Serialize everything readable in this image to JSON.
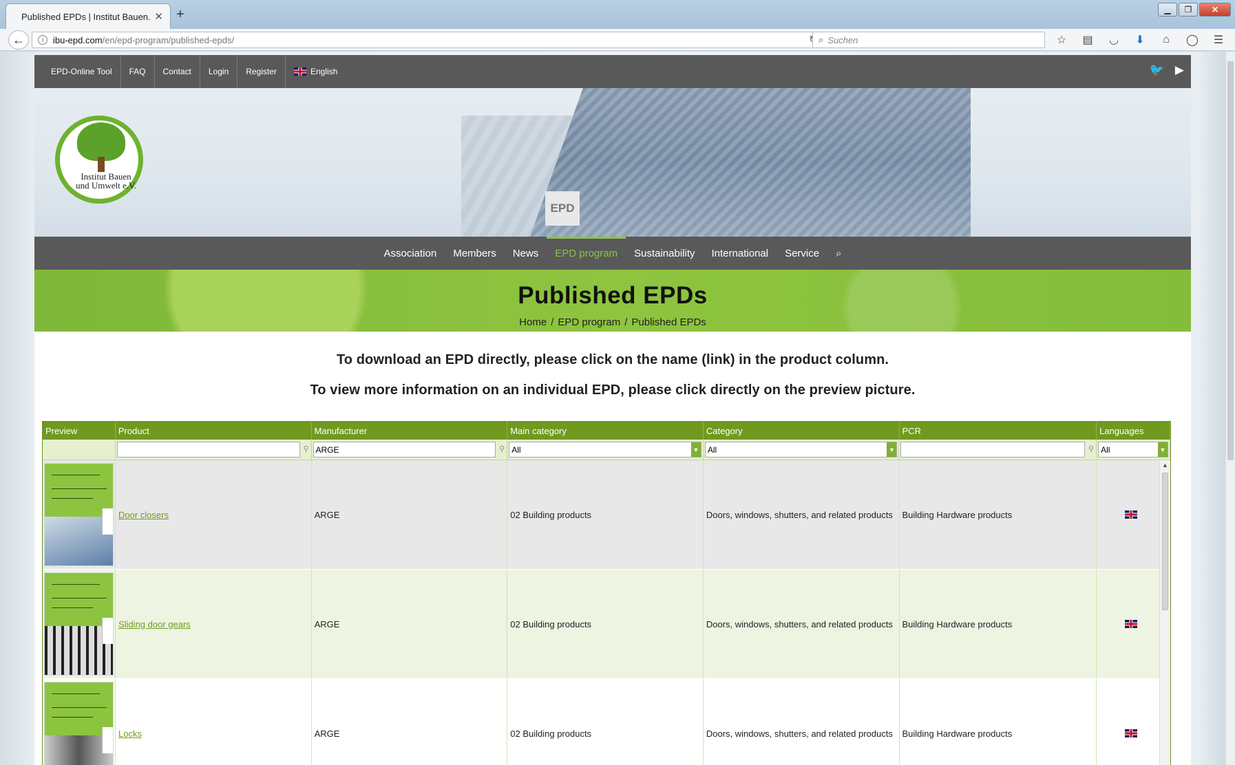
{
  "browser": {
    "tab_title": "Published EPDs | Institut Bauen...",
    "tab_close": "✕",
    "new_tab": "+",
    "url_host": "ibu-epd.com",
    "url_path": "/en/epd-program/published-epds/",
    "search_placeholder": "Suchen"
  },
  "site": {
    "toplinks": [
      "EPD-Online Tool",
      "FAQ",
      "Contact",
      "Login",
      "Register"
    ],
    "language": "English",
    "hero_sign": "EPD",
    "logo_text_line1": "Institut Bauen",
    "logo_text_line2": "und Umwelt e.V.",
    "mainnav": [
      "Association",
      "Members",
      "News",
      "EPD program",
      "Sustainability",
      "International",
      "Service"
    ],
    "page_title": "Published EPDs",
    "breadcrumb": [
      "Home",
      "EPD program",
      "Published EPDs"
    ],
    "intro_line1": "To download an EPD directly, please click on the name (link) in the product column.",
    "intro_line2": "To view more information on an individual EPD, please click directly on the preview picture."
  },
  "table": {
    "headers": [
      "Preview",
      "Product",
      "Manufacturer",
      "Main category",
      "Category",
      "PCR",
      "Languages"
    ],
    "filters": {
      "product": "",
      "manufacturer": "ARGE",
      "main_category": "All",
      "category": "All",
      "pcr": "",
      "languages": "All"
    },
    "rows": [
      {
        "product": "Door closers",
        "manufacturer": "ARGE",
        "main_category": "02 Building products",
        "category": "Doors, windows, shutters, and related products",
        "pcr": "Building Hardware products"
      },
      {
        "product": "Sliding door gears",
        "manufacturer": "ARGE",
        "main_category": "02 Building products",
        "category": "Doors, windows, shutters, and related products",
        "pcr": "Building Hardware products"
      },
      {
        "product": "Locks",
        "manufacturer": "ARGE",
        "main_category": "02 Building products",
        "category": "Doors, windows, shutters, and related products",
        "pcr": "Building Hardware products"
      }
    ]
  },
  "colors": {
    "brand_green": "#8bc34a",
    "header_green": "#6f9a1f",
    "nav_gray": "#595959"
  }
}
